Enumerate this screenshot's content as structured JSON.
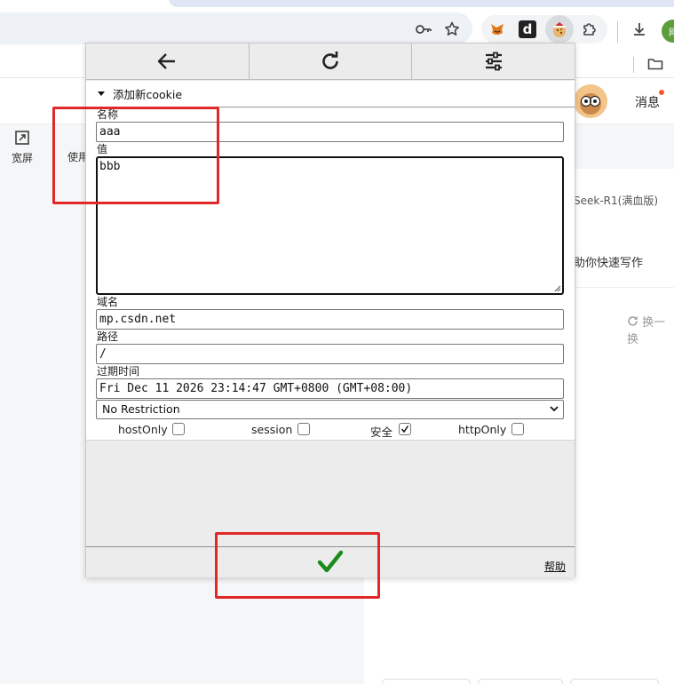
{
  "browser": {
    "extensions": [
      {
        "name": "metamask-fox-icon"
      },
      {
        "name": "d-extension-icon",
        "letter": "d"
      },
      {
        "name": "cookie-editor-icon"
      },
      {
        "name": "extensions-puzzle-icon"
      }
    ],
    "profile_text": "网"
  },
  "page": {
    "fullscreen_label": "宽屏",
    "use_label": "使用",
    "messages_label": "消息",
    "side_line1": "Seek-R1(满血版)",
    "side_line2": "助你快速写作",
    "refresh_label": "换一换"
  },
  "popup": {
    "section_title": "添加新cookie",
    "name_label": "名称",
    "name_value": "aaa",
    "value_label": "值",
    "value_value": "bbb",
    "domain_label": "域名",
    "domain_value": "mp.csdn.net",
    "path_label": "路径",
    "path_value": "/",
    "expiry_label": "过期时间",
    "expiry_value": "Fri Dec 11 2026 23:14:47 GMT+0800 (GMT+08:00)",
    "samesite_selected": "No Restriction",
    "flags": [
      {
        "label": "hostOnly",
        "checked": false
      },
      {
        "label": "session",
        "checked": false
      },
      {
        "label": "安全",
        "checked": true
      },
      {
        "label": "httpOnly",
        "checked": false
      }
    ],
    "help_label": "帮助"
  },
  "colors": {
    "annotation_red": "#e02828",
    "confirm_green": "#1a8a1a"
  }
}
